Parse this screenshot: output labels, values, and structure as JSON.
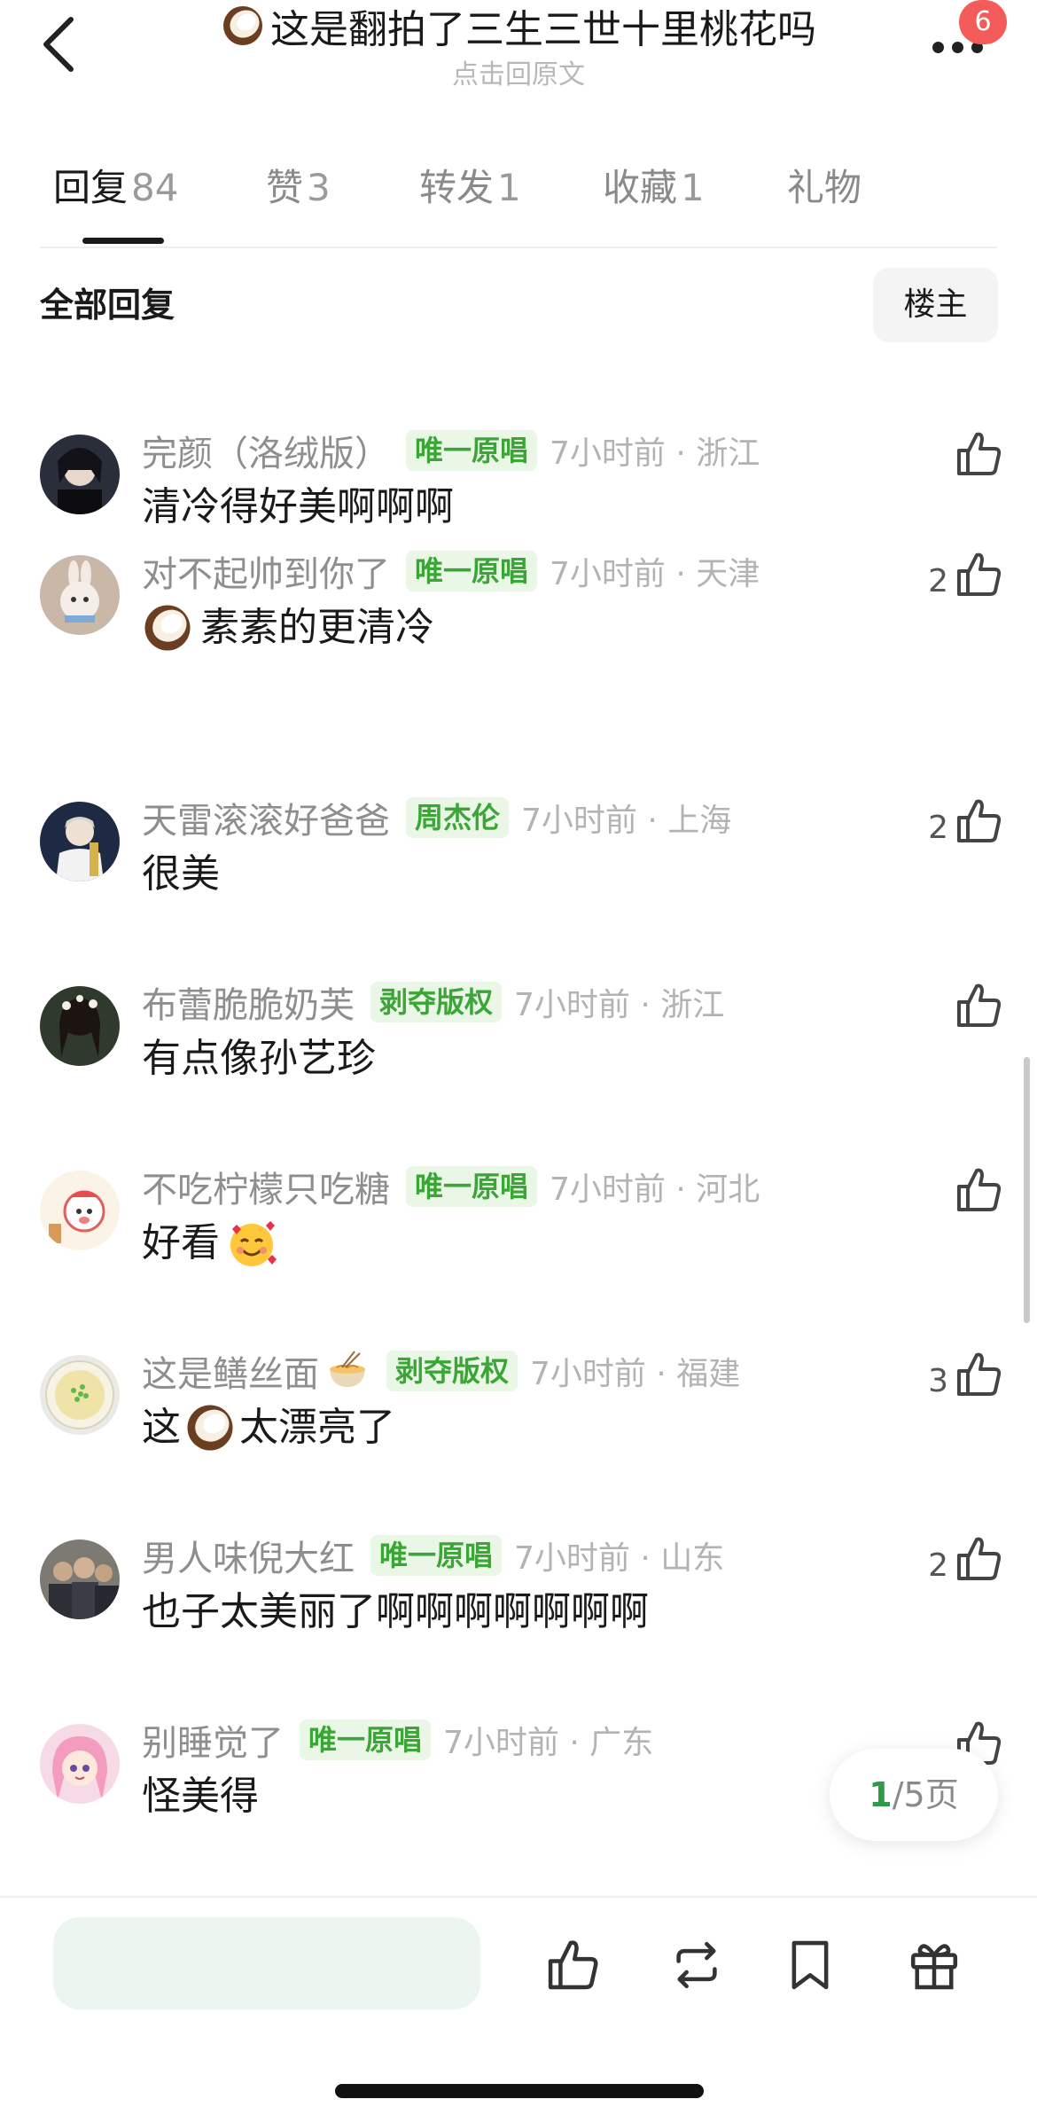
{
  "header": {
    "title": "这是翻拍了三生三世十里桃花吗",
    "title_icon": "coconut-emoji",
    "subtitle": "点击回原文",
    "notification_count": "6"
  },
  "tabs": [
    {
      "label": "回复",
      "count": "84",
      "active": true
    },
    {
      "label": "赞",
      "count": "3",
      "active": false
    },
    {
      "label": "转发",
      "count": "1",
      "active": false
    },
    {
      "label": "收藏",
      "count": "1",
      "active": false
    },
    {
      "label": "礼物",
      "count": "",
      "active": false
    }
  ],
  "filter": {
    "all_replies": "全部回复",
    "op_only": "楼主"
  },
  "comments": [
    {
      "username": "完颜（洛绒版）",
      "tag": "唯一原唱",
      "time": "7小时前 · 浙江",
      "content": "清冷得好美啊啊啊",
      "likes": "",
      "avatar": "avatar-dark-hair"
    },
    {
      "username": "对不起帅到你了",
      "tag": "唯一原唱",
      "time": "7小时前 · 天津",
      "content": "素素的更清冷",
      "content_prefix_emoji": "coconut-emoji",
      "likes": "2",
      "avatar": "avatar-bunny"
    },
    {
      "username": "天雷滚滚好爸爸",
      "tag": "周杰伦",
      "time": "7小时前 · 上海",
      "content": "很美",
      "likes": "2",
      "avatar": "avatar-player"
    },
    {
      "username": "布蕾脆脆奶芙",
      "tag": "剥夺版权",
      "time": "7小时前 · 浙江",
      "content": "有点像孙艺珍",
      "likes": "",
      "avatar": "avatar-girl"
    },
    {
      "username": "不吃柠檬只吃糖",
      "tag": "唯一原唱",
      "time": "7小时前 · 河北",
      "content": "好看",
      "content_suffix_emoji": "smiling-face-with-hearts",
      "likes": "",
      "avatar": "avatar-cartoon"
    },
    {
      "username": "这是鳝丝面",
      "username_emoji": "noodle-bowl",
      "tag": "剥夺版权",
      "time": "7小时前 · 福建",
      "content_before": "这",
      "content_after": "太漂亮了",
      "content_mid_emoji": "coconut-emoji",
      "likes": "3",
      "avatar": "avatar-noodle"
    },
    {
      "username": "男人味倪大红",
      "tag": "唯一原唱",
      "time": "7小时前 · 山东",
      "content": "也子太美丽了啊啊啊啊啊啊啊",
      "likes": "2",
      "avatar": "avatar-group"
    },
    {
      "username": "别睡觉了",
      "tag": "唯一原唱",
      "time": "7小时前 · 广东",
      "content": "怪美得",
      "likes": "",
      "avatar": "avatar-anime"
    }
  ],
  "pager": {
    "current": "1",
    "total": "/5页"
  },
  "colors": {
    "accent_green": "#3aa635",
    "tag_bg": "#eaf6e6",
    "badge_red": "#f45b5b"
  }
}
